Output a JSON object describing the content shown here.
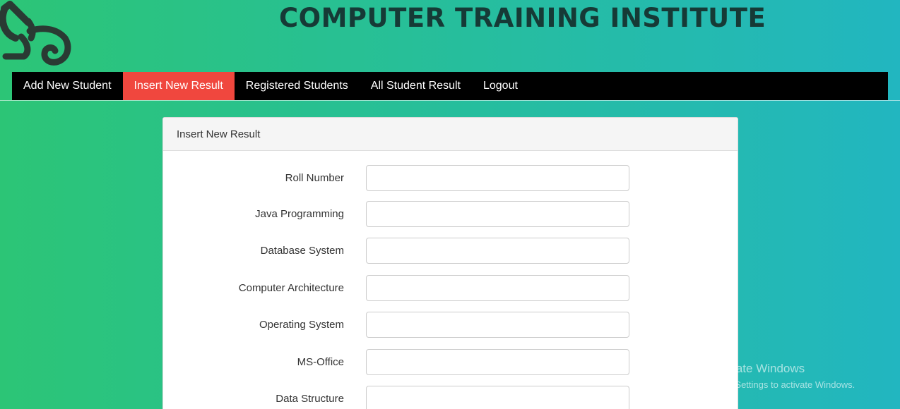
{
  "site": {
    "title": "COMPUTER TRAINING INSTITUTE"
  },
  "nav": {
    "items": [
      {
        "label": "Add New Student",
        "active": false
      },
      {
        "label": "Insert New Result",
        "active": true
      },
      {
        "label": "Registered Students",
        "active": false
      },
      {
        "label": "All Student Result",
        "active": false
      },
      {
        "label": "Logout",
        "active": false
      }
    ],
    "active_color": "#f0473e"
  },
  "panel": {
    "heading": "Insert New Result",
    "fields": [
      {
        "label": "Roll Number",
        "value": ""
      },
      {
        "label": "Java Programming",
        "value": ""
      },
      {
        "label": "Database System",
        "value": ""
      },
      {
        "label": "Computer Architecture",
        "value": ""
      },
      {
        "label": "Operating System",
        "value": ""
      },
      {
        "label": "MS-Office",
        "value": ""
      },
      {
        "label": "Data Structure",
        "value": ""
      }
    ]
  },
  "watermark": {
    "title": "Activate Windows",
    "subtitle": "Go to Settings to activate Windows."
  }
}
